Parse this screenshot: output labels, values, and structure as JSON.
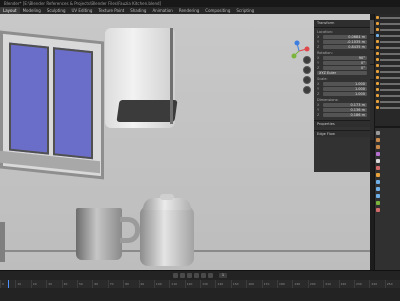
{
  "window": {
    "title": "Blender* [E:\\Blender References & Projects\\Blender Files\\Fauzia Kitchen.blend]"
  },
  "workspaces": [
    {
      "label": "Layout",
      "active": true
    },
    {
      "label": "Modeling",
      "active": false
    },
    {
      "label": "Sculpting",
      "active": false
    },
    {
      "label": "UV Editing",
      "active": false
    },
    {
      "label": "Texture Paint",
      "active": false
    },
    {
      "label": "Shading",
      "active": false
    },
    {
      "label": "Animation",
      "active": false
    },
    {
      "label": "Rendering",
      "active": false
    },
    {
      "label": "Compositing",
      "active": false
    },
    {
      "label": "Scripting",
      "active": false
    }
  ],
  "n_panel": {
    "header": "Transform",
    "location_label": "Location:",
    "location": [
      {
        "axis": "X",
        "value": "0.0684 m"
      },
      {
        "axis": "Y",
        "value": "-0.1035 m"
      },
      {
        "axis": "Z",
        "value": "0.8435 m"
      }
    ],
    "rotation_label": "Rotation:",
    "rotation": [
      {
        "axis": "X",
        "value": "90°"
      },
      {
        "axis": "Y",
        "value": "0°"
      },
      {
        "axis": "Z",
        "value": "0°"
      }
    ],
    "mode": "XYZ Euler",
    "scale_label": "Scale:",
    "scale": [
      {
        "axis": "X",
        "value": "1.000"
      },
      {
        "axis": "Y",
        "value": "1.000"
      },
      {
        "axis": "Z",
        "value": "1.000"
      }
    ],
    "dimensions_label": "Dimensions:",
    "dimensions": [
      {
        "axis": "X",
        "value": "0.173 m"
      },
      {
        "axis": "Y",
        "value": "0.136 m"
      },
      {
        "axis": "Z",
        "value": "0.186 m"
      }
    ],
    "collapsed": [
      "Properties",
      "Edge Flow"
    ]
  },
  "timeline": {
    "current_frame": "1",
    "ticks": [
      "0",
      "10",
      "20",
      "30",
      "40",
      "50",
      "60",
      "70",
      "80",
      "90",
      "100",
      "110",
      "120",
      "130",
      "140",
      "150",
      "160",
      "170",
      "180",
      "190",
      "200",
      "210",
      "220",
      "230",
      "240",
      "250"
    ]
  },
  "colors": {
    "accent": "#4d90fe",
    "gizmo_x": "#e0474b",
    "gizmo_y": "#7ab43c",
    "gizmo_z": "#3d7ee0",
    "window_glass": "#6b6ec9"
  }
}
